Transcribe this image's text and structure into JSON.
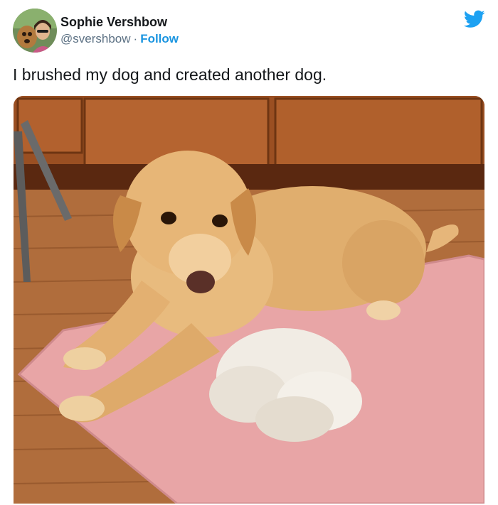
{
  "tweet": {
    "author": {
      "display_name": "Sophie Vershbow",
      "handle": "@svershbow",
      "separator": "·",
      "follow_label": "Follow"
    },
    "text": "I brushed my dog and created another dog.",
    "brand_icon": "twitter-bird-icon",
    "photo": {
      "icon": "dog-photo",
      "subject": "dog lying on a pink mat beside a large pile of brushed-out fur"
    }
  },
  "colors": {
    "link": "#1b95e0",
    "brand": "#1da1f2",
    "text": "#14171a",
    "secondary_text": "#5b7083"
  }
}
